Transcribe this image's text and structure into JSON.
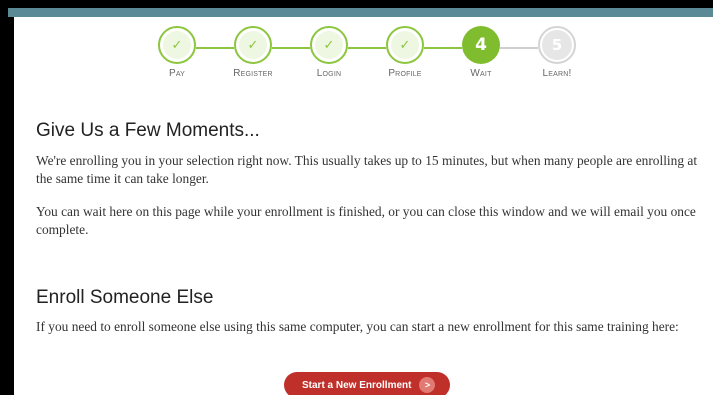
{
  "stepper": {
    "steps": [
      {
        "label": "Pay",
        "glyph": "✓",
        "state": "done"
      },
      {
        "label": "Register",
        "glyph": "✓",
        "state": "done"
      },
      {
        "label": "Login",
        "glyph": "✓",
        "state": "done"
      },
      {
        "label": "Profile",
        "glyph": "✓",
        "state": "done"
      },
      {
        "label": "Wait",
        "glyph": "4",
        "state": "current"
      },
      {
        "label": "Learn!",
        "glyph": "5",
        "state": "future"
      }
    ]
  },
  "wait_section": {
    "heading": "Give Us a Few Moments...",
    "paragraph1": "We're enrolling you in your selection right now. This usually takes up to 15 minutes, but when many people are enrolling at the same time it can take longer.",
    "paragraph2": "You can wait here on this page while your enrollment is finished, or you can close this window and we will email you once complete."
  },
  "enroll_section": {
    "heading": "Enroll Someone Else",
    "paragraph": "If you need to enroll someone else using this same computer, you can start a new enrollment for this same training here:",
    "button_label": "Start a New Enrollment",
    "button_arrow": ">"
  },
  "colors": {
    "accent_green": "#8cc63f",
    "button_red": "#c0302a",
    "topbar": "#5b8a96"
  }
}
